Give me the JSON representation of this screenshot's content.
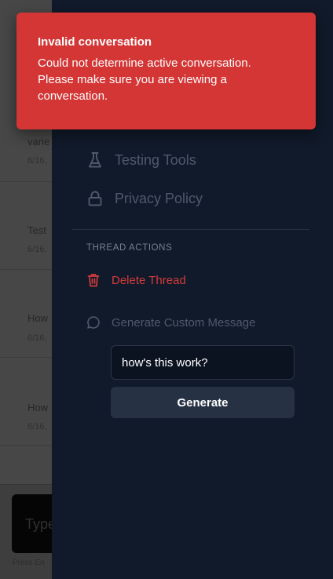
{
  "background": {
    "items": [
      {
        "title": "varie",
        "date": "6/16,"
      },
      {
        "title": "Test",
        "date": "6/16,"
      },
      {
        "title": "How",
        "date": "6/16,"
      },
      {
        "title": "How",
        "date": "6/16,"
      }
    ],
    "composer_placeholder": "Type",
    "hint": "Press En"
  },
  "menu": {
    "items": [
      {
        "label": "Testing Tools",
        "icon": "flask-icon"
      },
      {
        "label": "Privacy Policy",
        "icon": "lock-icon"
      }
    ]
  },
  "thread_actions": {
    "title": "THREAD ACTIONS",
    "delete_label": "Delete Thread",
    "generate_label": "Generate Custom Message",
    "input_value": "how's this work?",
    "button_label": "Generate"
  },
  "toast": {
    "title": "Invalid conversation",
    "message": "Could not determine active conversation. Please make sure you are viewing a conversation."
  },
  "colors": {
    "panel_bg": "#111a2a",
    "toast_bg": "#d43535",
    "danger": "#d23b3b",
    "button_bg": "#263244",
    "muted_text": "#4e596b"
  }
}
